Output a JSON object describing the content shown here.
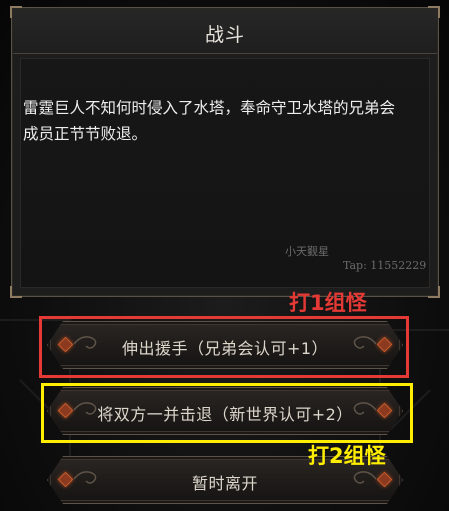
{
  "dialog": {
    "title": "战斗",
    "text": "雷霆巨人不知何时侵入了水塔，奉命守卫水塔的兄弟会成员正节节败退。"
  },
  "watermark": {
    "name": "小天觐星",
    "tap": "Tap: 11552229"
  },
  "options": [
    {
      "label": "伸出援手（兄弟会认可+1）"
    },
    {
      "label": "将双方一并击退（新世界认可+2）"
    },
    {
      "label": "暂时离开"
    }
  ],
  "annotations": {
    "red": "打1组怪",
    "yellow": "打2组怪"
  },
  "colors": {
    "annotation_red": "#e53935",
    "annotation_yellow": "#ffee00",
    "gem": "#c25b2b"
  }
}
